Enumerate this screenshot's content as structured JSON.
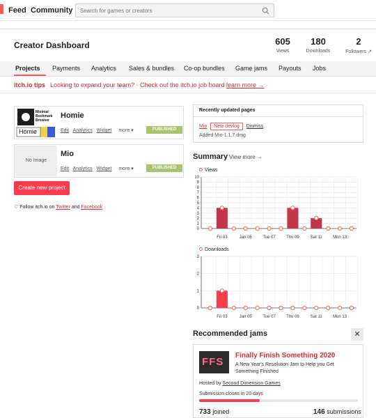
{
  "header": {
    "nav": [
      "Feed",
      "Community"
    ],
    "search_placeholder": "Search for games or creators"
  },
  "dashboard": {
    "title": "Creator Dashboard",
    "stats": [
      {
        "value": "605",
        "label": "Views"
      },
      {
        "value": "180",
        "label": "Downloads"
      },
      {
        "value": "2",
        "label": "Followers ↗"
      }
    ]
  },
  "tabs": [
    "Projects",
    "Payments",
    "Analytics",
    "Sales & bundles",
    "Co-op bundles",
    "Game jams",
    "Payouts",
    "Jobs"
  ],
  "tips": {
    "label": "itch.io tips",
    "text": "Looking to expand your team? · Check out the itch.io job board",
    "link": "learn more →"
  },
  "games": [
    {
      "name": "Homie",
      "thumb_text": "Minimal Bookmark Browser",
      "thumb_logo": "Homie",
      "links": [
        "Edit",
        "Analytics",
        "Widget",
        "more ▾"
      ],
      "status": "PUBLISHED"
    },
    {
      "name": "Mio",
      "thumb_text": "No Image",
      "links": [
        "Edit",
        "Analytics",
        "Widget",
        "more ▾"
      ],
      "status": "PUBLISHED"
    }
  ],
  "create_button": "Create new project",
  "follow": {
    "prefix": "♡ Follow itch.io on",
    "twitter": "Twitter",
    "and": "and",
    "facebook": "Facebook"
  },
  "recent": {
    "title": "Recently updated pages",
    "game_link": "Mio",
    "pill": "New devlog",
    "dismiss": "Dismiss",
    "sub": "Added Mio-1.1.7.dmg"
  },
  "summary": {
    "title": "Summary",
    "view_more": "View more →"
  },
  "chart_data": [
    {
      "type": "bar",
      "legend": "Views",
      "ylim": [
        0,
        10
      ],
      "yticks": [
        "0",
        "1",
        "2",
        "3",
        "4",
        "5",
        "6",
        "7",
        "8",
        "9",
        "10"
      ],
      "x_tick_labels": [
        "Fri 03",
        "Jan 05",
        "Tue 07",
        "Thu 09",
        "Sat 11",
        "Mon 13"
      ],
      "values": [
        0,
        4,
        0,
        0,
        0,
        0,
        0,
        4,
        0,
        2,
        0,
        0,
        0
      ],
      "colors": {
        "bar": "#c2364a",
        "point": "#fa5c5c"
      }
    },
    {
      "type": "bar",
      "legend": "Downloads",
      "ylim": [
        0,
        3
      ],
      "yticks": [
        "0",
        "1",
        "2",
        "3"
      ],
      "x_tick_labels": [
        "Fri 03",
        "Jan 05",
        "Tue 07",
        "Thu 09",
        "Sat 11",
        "Mon 13"
      ],
      "values": [
        0,
        1,
        0,
        0,
        0,
        0,
        0,
        0,
        0,
        0,
        0,
        0,
        0
      ],
      "colors": {
        "bar": "#fa3c4c",
        "point": "#fa5c5c"
      }
    }
  ],
  "jams": {
    "title": "Recommended jams",
    "close": "✕",
    "name": "Finally Finish Something 2020",
    "logo": "FFS",
    "description": "A New Year's Resolution Jam to Help you Get Something Finished",
    "hosted_prefix": "Hosted by",
    "host": "Second Dimension Games",
    "closes": "Submission closes in 20 days",
    "progress": 0.38,
    "joined_num": "733",
    "joined_label": "joined",
    "submissions_num": "146",
    "submissions_label": "submissions"
  }
}
